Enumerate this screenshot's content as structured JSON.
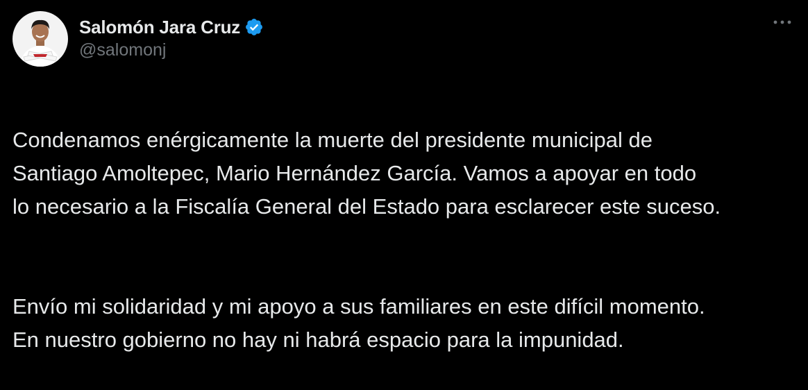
{
  "tweet": {
    "author": {
      "display_name": "Salomón Jara Cruz",
      "handle": "@salomonj",
      "verified": true
    },
    "paragraphs": [
      "Condenamos enérgicamente la muerte del presidente municipal de\nSantiago Amoltepec, Mario Hernández García. Vamos a apoyar en todo\nlo necesario a la Fiscalía General del Estado para esclarecer este suceso.",
      "Envío mi solidaridad y mi apoyo a sus familiares en este difícil momento.\nEn nuestro gobierno no hay ni habrá espacio para la impunidad."
    ]
  },
  "icons": {
    "verified": "verified-badge-icon",
    "more": "more-options-icon"
  },
  "colors": {
    "background": "#000000",
    "text_primary": "#e7e9ea",
    "text_secondary": "#71767b",
    "verified_blue": "#1d9bf0"
  }
}
